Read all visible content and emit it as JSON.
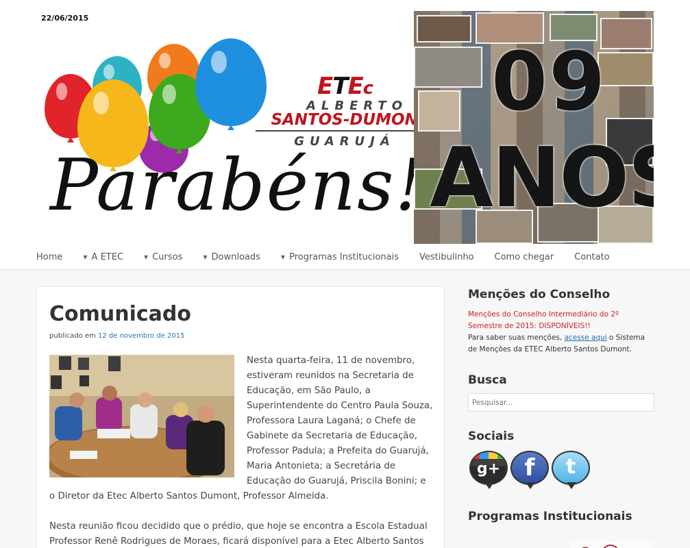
{
  "banner": {
    "date": "22/06/2015",
    "parabens": "Parabéns!",
    "logo_e1": "E",
    "logo_t": "T",
    "logo_e2": "E",
    "logo_c": "c",
    "school_line1": "ALBERTO",
    "school_line2": "SANTOS-DUMONT",
    "school_line3": "GUARUJÁ",
    "anos_number": "09",
    "anos_word": "ANOS"
  },
  "nav": {
    "items": [
      {
        "label": "Home",
        "dropdown": false
      },
      {
        "label": "A ETEC",
        "dropdown": true
      },
      {
        "label": "Cursos",
        "dropdown": true
      },
      {
        "label": "Downloads",
        "dropdown": true
      },
      {
        "label": "Programas Institucionais",
        "dropdown": true
      },
      {
        "label": "Vestibulinho",
        "dropdown": false
      },
      {
        "label": "Como chegar",
        "dropdown": false
      },
      {
        "label": "Contato",
        "dropdown": false
      }
    ],
    "dropdown_marker": "▼"
  },
  "post": {
    "title": "Comunicado",
    "meta_prefix": "publicado em",
    "meta_date": "12 de novembro de 2015",
    "paragraph1": "Nesta quarta-feira, 11 de novembro, estiveram reunidos na Secretaria de Educação, em São Paulo, a Superintendente do Centro Paula Souza, Professora Laura Laganá; o Chefe de Gabinete da Secretaria de Educação, Professor Padula; a Prefeita do Guarujá, Maria Antonieta; a Secretária de Educação do Guarujá, Priscila Bonini; e o Diretor da Etec Alberto Santos Dumont, Professor Almeida.",
    "paragraph2": "Nesta reunião ficou decidido que o prédio, que hoje se encontra a Escola Estadual Professor Renê Rodrigues de Moraes, ficará disponível para a Etec Alberto Santos"
  },
  "sidebar": {
    "mencoes": {
      "title": "Menções do Conselho",
      "alert": "Menções do Conselho Intermediário do 2º Semestre de 2015: DISPONÍVEIS!!",
      "text_before": "Para saber suas menções, ",
      "link": "acesse aqui",
      "text_after": " o Sistema de Menções da ETEC Alberto Santos Dumont."
    },
    "busca": {
      "title": "Busca",
      "placeholder": "Pesquisar..."
    },
    "sociais": {
      "title": "Sociais",
      "icons": [
        "google-plus-icon",
        "facebook-icon",
        "twitter-icon"
      ]
    },
    "programas": {
      "title": "Programas Institucionais"
    }
  },
  "colors": {
    "accent_red": "#c0151d",
    "alert_red": "#d11d1d",
    "link_blue": "#2a6fb3",
    "text": "#333333"
  }
}
